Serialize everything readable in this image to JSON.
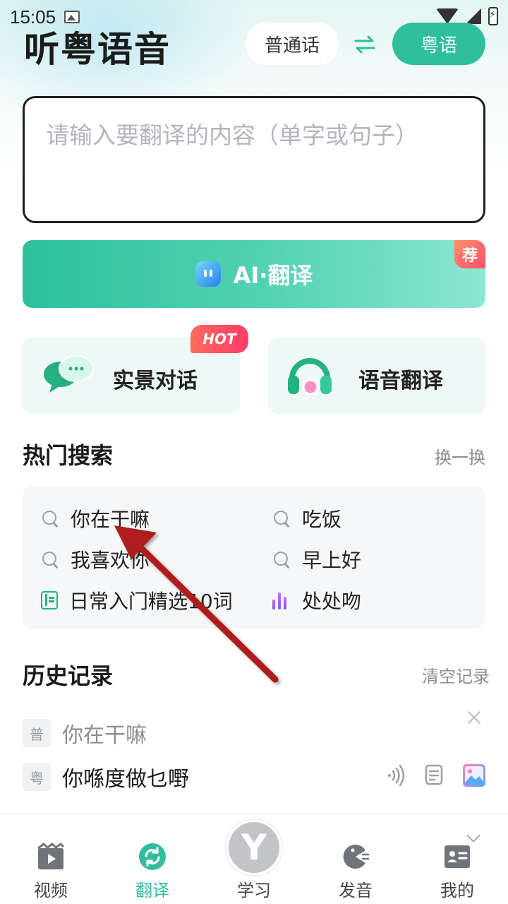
{
  "status_bar": {
    "time": "15:05"
  },
  "header": {
    "app_title": "听粤语音",
    "source_lang": "普通话",
    "target_lang": "粤语"
  },
  "translate_input": {
    "placeholder": "请输入要翻译的内容（单字或句子）"
  },
  "ai_button": {
    "label": "AI·翻译",
    "badge": "荐"
  },
  "features": [
    {
      "label": "实景对话",
      "badge": "HOT",
      "icon": "chat-bubble-icon"
    },
    {
      "label": "语音翻译",
      "icon": "headset-icon"
    }
  ],
  "hot_search": {
    "title": "热门搜索",
    "refresh_label": "换一换",
    "items": [
      {
        "text": "你在干嘛",
        "icon": "search-icon"
      },
      {
        "text": "吃饭",
        "icon": "search-icon"
      },
      {
        "text": "我喜欢你",
        "icon": "search-icon"
      },
      {
        "text": "早上好",
        "icon": "search-icon"
      },
      {
        "text": "日常入门精选10词",
        "icon": "book-icon"
      },
      {
        "text": "处处吻",
        "icon": "audio-bars-icon"
      }
    ]
  },
  "history": {
    "title": "历史记录",
    "clear_label": "清空记录",
    "entries": [
      {
        "src_tag": "普",
        "src_text": "你在干嘛",
        "dst_tag": "粤",
        "dst_text": "你喺度做乜嘢"
      }
    ]
  },
  "tabbar": {
    "items": [
      {
        "label": "视频",
        "icon": "video-icon"
      },
      {
        "label": "翻译",
        "icon": "translate-icon",
        "active": true
      },
      {
        "label": "学习",
        "icon": "y-logo-icon"
      },
      {
        "label": "发音",
        "icon": "pronounce-icon"
      },
      {
        "label": "我的",
        "icon": "profile-card-icon"
      }
    ],
    "center_logo": "Y"
  },
  "colors": {
    "accent": "#2fbf9c",
    "hot_badge": "#ff4a63",
    "annotation_arrow": "#b01e1e"
  }
}
